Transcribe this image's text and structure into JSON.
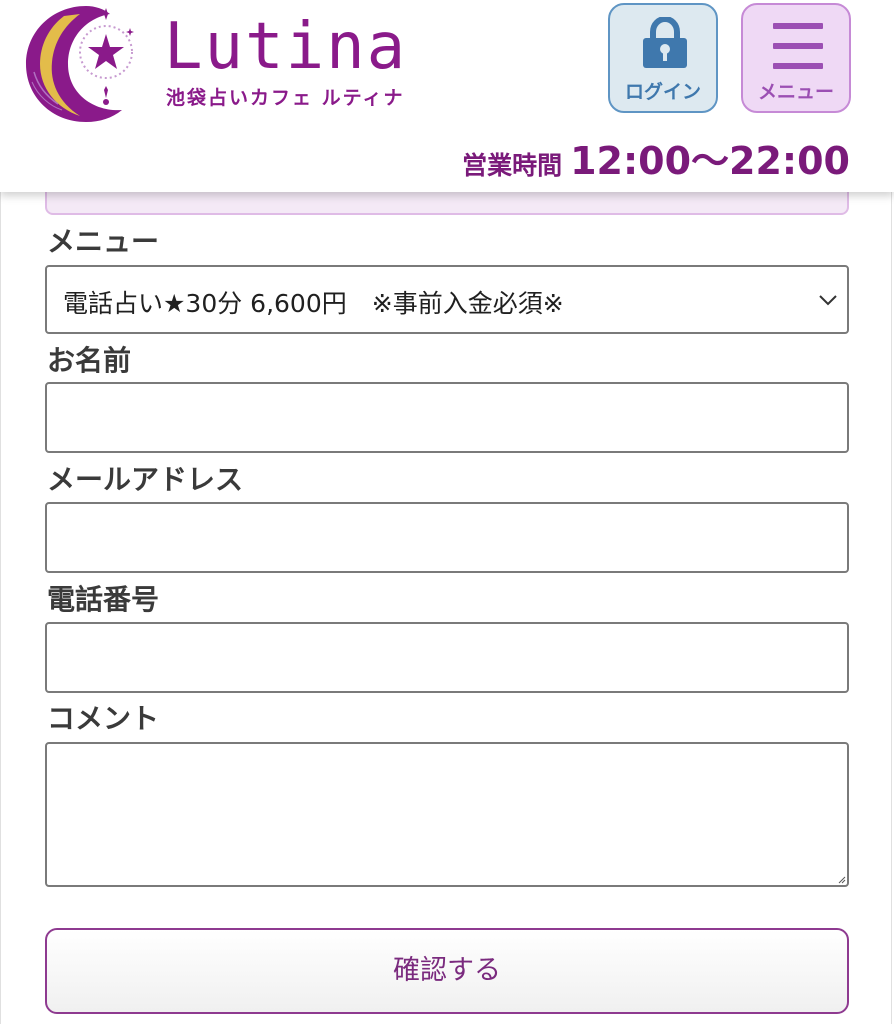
{
  "header": {
    "brand_name": "Lutina",
    "brand_subtitle": "池袋占いカフェ ルティナ",
    "login_label": "ログイン",
    "menu_label": "メニュー",
    "hours_label": "営業時間",
    "hours_value": "12:00〜22:00",
    "icons": {
      "logo": "crescent-moon-star-logo",
      "login": "lock-icon",
      "menu": "hamburger-icon"
    }
  },
  "form": {
    "menu_label": "メニュー",
    "menu_selected": "電話占い★30分 6,600円　※事前入金必須※",
    "name_label": "お名前",
    "name_value": "",
    "email_label": "メールアドレス",
    "email_value": "",
    "phone_label": "電話番号",
    "phone_value": "",
    "comment_label": "コメント",
    "comment_value": "",
    "submit_label": "確認する"
  },
  "colors": {
    "brand_purple": "#8a1a8a",
    "login_blue": "#3f78ad",
    "menu_purple": "#9b4fb3",
    "gold": "#e8c547"
  }
}
